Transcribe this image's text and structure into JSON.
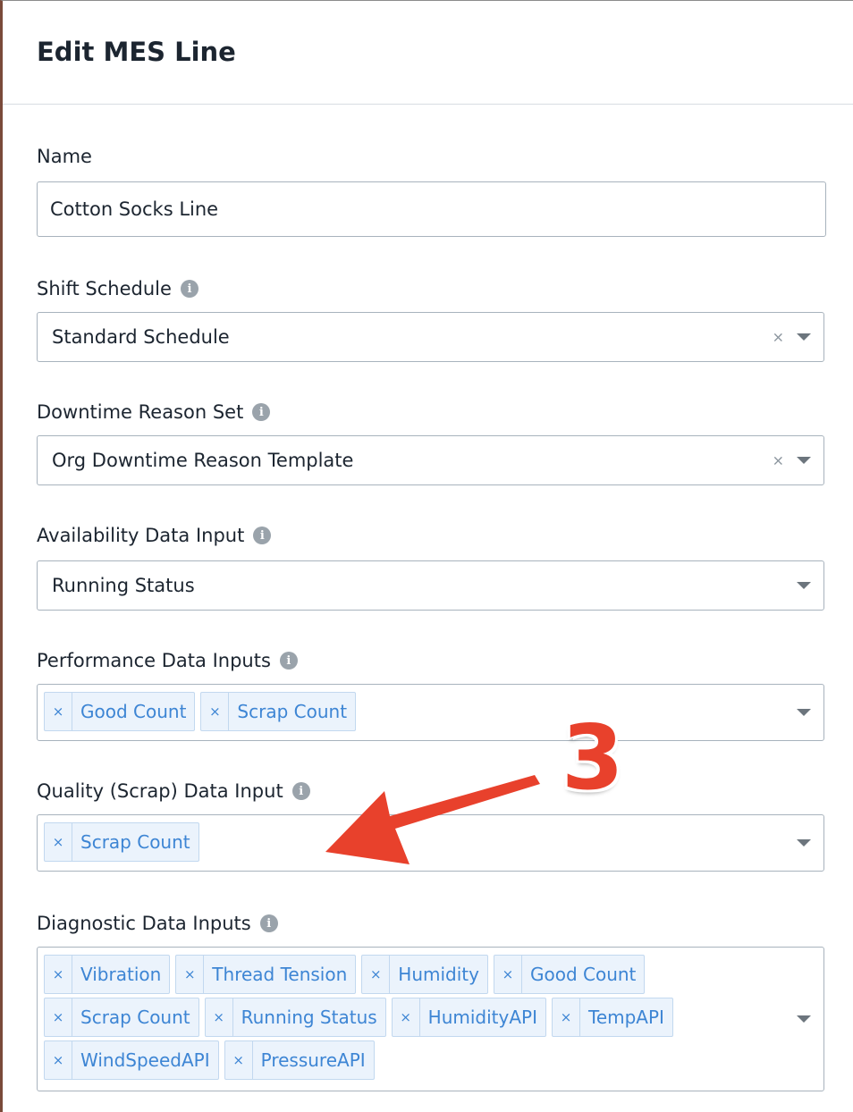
{
  "modal": {
    "title": "Edit MES Line"
  },
  "fields": {
    "name": {
      "label": "Name",
      "value": "Cotton Socks Line"
    },
    "shift_schedule": {
      "label": "Shift Schedule",
      "value": "Standard Schedule"
    },
    "downtime_reason_set": {
      "label": "Downtime Reason Set",
      "value": "Org Downtime Reason Template"
    },
    "availability_input": {
      "label": "Availability Data Input",
      "value": "Running Status"
    },
    "performance_inputs": {
      "label": "Performance Data Inputs",
      "tags": [
        "Good Count",
        "Scrap Count"
      ]
    },
    "quality_input": {
      "label": "Quality (Scrap) Data Input",
      "tags": [
        "Scrap Count"
      ]
    },
    "diagnostic_inputs": {
      "label": "Diagnostic Data Inputs",
      "tags": [
        "Vibration",
        "Thread Tension",
        "Humidity",
        "Good Count",
        "Scrap Count",
        "Running Status",
        "HumidityAPI",
        "TempAPI",
        "WindSpeedAPI",
        "PressureAPI"
      ]
    }
  },
  "symbols": {
    "clear": "×",
    "remove": "×",
    "info": "i"
  },
  "annotation": {
    "number": "3",
    "color": "#e8412c"
  },
  "icons": {
    "info": "info-icon",
    "caret": "chevron-down-icon",
    "clear": "close-icon"
  }
}
